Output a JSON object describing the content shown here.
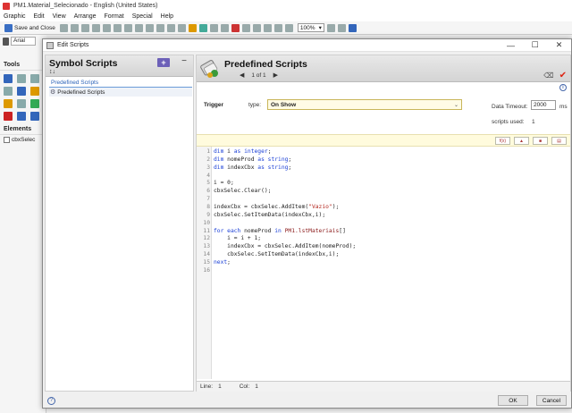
{
  "app": {
    "title": "PM1.Material_Selecionado - English (United States)",
    "menu": [
      "Graphic",
      "Edit",
      "View",
      "Arrange",
      "Format",
      "Special",
      "Help"
    ],
    "save_close_label": "Save and Close",
    "zoom_value": "100%",
    "font_name": "Arial",
    "tools_label": "Tools",
    "elements_label": "Elements",
    "element_item": "cbxSelec"
  },
  "dialog": {
    "title": "Edit Scripts",
    "symbol_scripts": {
      "title": "Symbol Scripts",
      "add_label": "+",
      "collapse_label": "−",
      "group_label": "Predefined Scripts",
      "item_label": "Predefined Scripts"
    },
    "editor": {
      "title": "Predefined Scripts",
      "pager": "1 of 1",
      "trigger_label": "Trigger",
      "type_label": "type:",
      "type_value": "On Show",
      "timeout_label": "Data Timeout:",
      "timeout_value": "2000",
      "timeout_unit": "ms",
      "scripts_used_label": "scripts used:",
      "scripts_used_value": "1",
      "status_line_label": "Line:",
      "status_line_value": "1",
      "status_col_label": "Col:",
      "status_col_value": "1"
    },
    "code_lines": [
      [
        {
          "t": "dim ",
          "c": "kw"
        },
        {
          "t": "i "
        },
        {
          "t": "as integer",
          "c": "kw"
        },
        {
          "t": ";"
        }
      ],
      [
        {
          "t": "dim ",
          "c": "kw"
        },
        {
          "t": "nomeProd "
        },
        {
          "t": "as string",
          "c": "kw"
        },
        {
          "t": ";"
        }
      ],
      [
        {
          "t": "dim ",
          "c": "kw"
        },
        {
          "t": "indexCbx "
        },
        {
          "t": "as string",
          "c": "kw"
        },
        {
          "t": ";"
        }
      ],
      [],
      [
        {
          "t": "i = 0;"
        }
      ],
      [
        {
          "t": "cbxSelec.Clear();"
        }
      ],
      [],
      [
        {
          "t": "indexCbx = cbxSelec.AddItem("
        },
        {
          "t": "\"Vazio\"",
          "c": "str"
        },
        {
          "t": ");"
        }
      ],
      [
        {
          "t": "cbxSelec.SetItemData(indexCbx,i);"
        }
      ],
      [],
      [
        {
          "t": "for each ",
          "c": "kw"
        },
        {
          "t": "nomeProd "
        },
        {
          "t": "in ",
          "c": "kw"
        },
        {
          "t": "PM1.lstMateriais",
          "c": "tag"
        },
        {
          "t": "[]"
        }
      ],
      [
        {
          "t": "    i = i + 1;"
        }
      ],
      [
        {
          "t": "    indexCbx = cbxSelec.AddItem(nomeProd);"
        }
      ],
      [
        {
          "t": "    cbxSelec.SetItemData(indexCbx,i);"
        }
      ],
      [
        {
          "t": "next",
          "c": "kw"
        },
        {
          "t": ";"
        }
      ],
      []
    ],
    "ok_label": "OK",
    "cancel_label": "Cancel"
  }
}
